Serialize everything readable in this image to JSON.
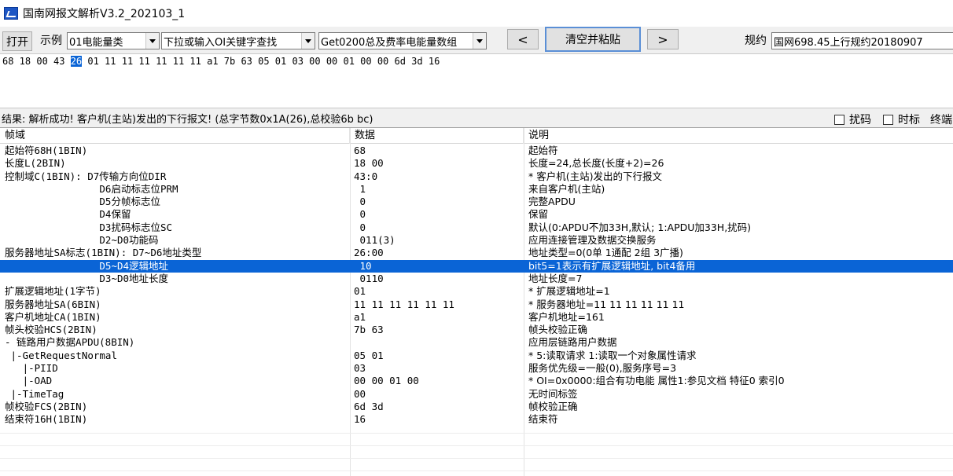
{
  "window": {
    "title": "国南网报文解析V3.2_202103_1"
  },
  "toolbar": {
    "open_label": "打开",
    "example_label": "示例",
    "example_select": "01电能量类",
    "oi_select": "下拉或输入OI关键字查找",
    "func_select": "Get0200总及费率电能量数组",
    "prev_label": "<",
    "clear_paste_label": "清空并粘贴",
    "next_label": ">",
    "protocol_label": "规约",
    "protocol_select": "国网698.45上行规约20180907"
  },
  "hex_input": {
    "before": "68 18 00 43 ",
    "selected": "26",
    "after": " 01 11 11 11 11 11 11 a1 7b 63 05 01 03 00 00 01 00 00 6d 3d 16"
  },
  "result": {
    "text": "结果: 解析成功! 客户机(主站)发出的下行报文! (总字节数0x1A(26),总校验6b bc)",
    "checkbox_scramble": "扰码",
    "checkbox_timetag": "时标",
    "checkbox_terminal": "终端"
  },
  "table": {
    "headers": [
      "帧域",
      "数据",
      "说明"
    ],
    "rows": [
      {
        "field": "起始符68H(1BIN)",
        "data": "68",
        "desc": "起始符"
      },
      {
        "field": "长度L(2BIN)",
        "data": "18 00",
        "desc": "长度=24,总长度(长度+2)=26"
      },
      {
        "field": "控制域C(1BIN): D7传输方向位DIR",
        "data": "43:0",
        "desc": "* 客户机(主站)发出的下行报文"
      },
      {
        "field": "                D6启动标志位PRM",
        "data": " 1",
        "desc": "来自客户机(主站)"
      },
      {
        "field": "                D5分帧标志位",
        "data": " 0",
        "desc": "完整APDU"
      },
      {
        "field": "                D4保留",
        "data": " 0",
        "desc": "保留"
      },
      {
        "field": "                D3扰码标志位SC",
        "data": " 0",
        "desc": "默认(0:APDU不加33H,默认; 1:APDU加33H,扰码)"
      },
      {
        "field": "                D2~D0功能码",
        "data": " 011(3)",
        "desc": "应用连接管理及数据交换服务"
      },
      {
        "field": "服务器地址SA标志(1BIN): D7~D6地址类型",
        "data": "26:00",
        "desc": "地址类型=0(0单 1通配 2组 3广播)"
      },
      {
        "field": "                D5~D4逻辑地址",
        "data": " 10",
        "desc": "bit5=1表示有扩展逻辑地址, bit4备用"
      },
      {
        "field": "                D3~D0地址长度",
        "data": " 0110",
        "desc": "地址长度=7"
      },
      {
        "field": "扩展逻辑地址(1字节)",
        "data": "01",
        "desc": "* 扩展逻辑地址=1"
      },
      {
        "field": "服务器地址SA(6BIN)",
        "data": "11 11 11 11 11 11",
        "desc": "* 服务器地址=11 11 11 11 11 11"
      },
      {
        "field": "客户机地址CA(1BIN)",
        "data": "a1",
        "desc": "客户机地址=161"
      },
      {
        "field": "帧头校验HCS(2BIN)",
        "data": "7b 63",
        "desc": "帧头校验正确"
      },
      {
        "field": "- 链路用户数据APDU(8BIN)",
        "data": "",
        "desc": "应用层链路用户数据"
      },
      {
        "field": " |-GetRequestNormal",
        "data": "05 01",
        "desc": "* 5:读取请求 1:读取一个对象属性请求"
      },
      {
        "field": "   |-PIID",
        "data": "03",
        "desc": "服务优先级=一般(0),服务序号=3"
      },
      {
        "field": "   |-OAD",
        "data": "00 00 01 00",
        "desc": "* OI=0x0000:组合有功电能 属性1:参见文档 特征0 索引0"
      },
      {
        "field": " |-TimeTag",
        "data": "00",
        "desc": "无时间标签"
      },
      {
        "field": "帧校验FCS(2BIN)",
        "data": "6d 3d",
        "desc": "帧校验正确"
      },
      {
        "field": "结束符16H(1BIN)",
        "data": "16",
        "desc": "结束符"
      }
    ],
    "selected_row": 9
  }
}
